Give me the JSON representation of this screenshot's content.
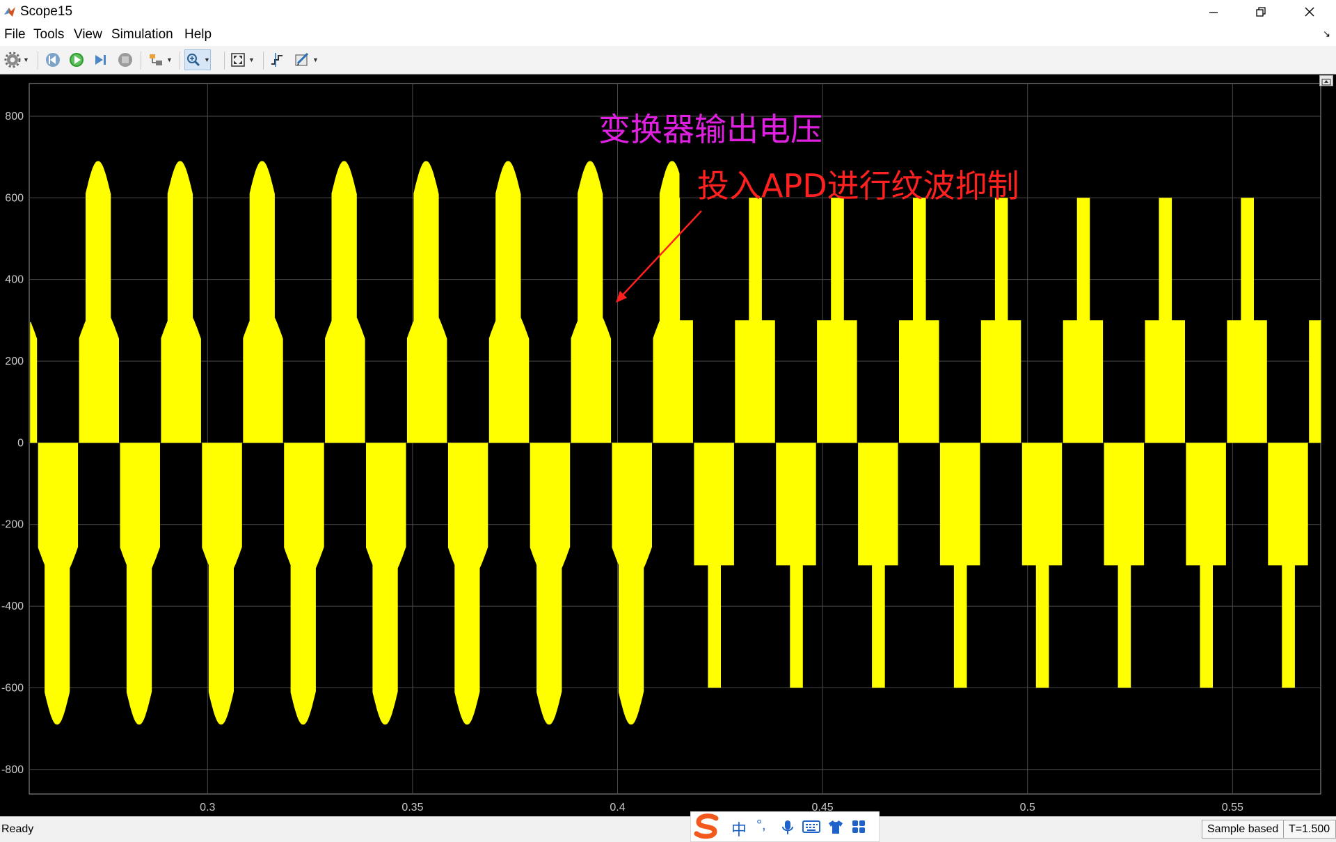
{
  "window": {
    "title": "Scope15",
    "controls": [
      "minimize",
      "restore",
      "close"
    ]
  },
  "menu": [
    {
      "label": "File"
    },
    {
      "label": "Tools"
    },
    {
      "label": "View"
    },
    {
      "label": "Simulation"
    },
    {
      "label": "Help"
    }
  ],
  "toolbar": {
    "icons": [
      "gear-icon",
      "step-back-icon",
      "run-icon",
      "step-forward-icon",
      "stop-icon",
      "highlight-block-icon",
      "zoom-icon",
      "fit-to-view-icon",
      "cursor-measure-icon",
      "style-icon"
    ]
  },
  "annotations": {
    "title_text": "变换器输出电压",
    "title_color": "#e020e0",
    "arrow_text": "投入APD进行纹波抑制",
    "arrow_color": "#ff2020"
  },
  "chart_data": {
    "type": "line",
    "xlim": [
      0.2565,
      0.5715
    ],
    "ylim": [
      -860,
      880
    ],
    "x_ticks": [
      0.3,
      0.35,
      0.4,
      0.45,
      0.5,
      0.55
    ],
    "y_ticks": [
      800,
      600,
      400,
      200,
      0,
      -200,
      -400,
      -600,
      -800
    ],
    "x_tick_labels": [
      "0.3",
      "0.35",
      "0.4",
      "0.45",
      "0.5",
      "0.55"
    ],
    "y_tick_labels": [
      "800",
      "600",
      "400",
      "200",
      "0",
      "-200",
      "-400",
      "-600",
      "-800"
    ],
    "grid": true,
    "series_color": "#ffff00",
    "fundamental_period": 0.02,
    "apd_start_time": 0.415,
    "series": [
      {
        "x": [
          0.257,
          0.259,
          0.2605,
          0.2625,
          0.2645,
          0.266,
          0.2675,
          0.27,
          0.272,
          0.2745,
          0.277,
          0.279,
          0.2805,
          0.2825,
          0.2845,
          0.286,
          0.2875,
          0.29,
          0.292,
          0.2945,
          0.297,
          0.299,
          0.3005,
          0.3025,
          0.3045,
          0.306,
          0.3075,
          0.31,
          0.312,
          0.3145,
          0.317,
          0.319,
          0.3205,
          0.3225,
          0.3245,
          0.326,
          0.3275,
          0.33,
          0.332,
          0.3345,
          0.337,
          0.339,
          0.3405,
          0.3425,
          0.3445,
          0.346,
          0.3475,
          0.35,
          0.352,
          0.3545,
          0.357,
          0.359,
          0.3605,
          0.3625,
          0.3645,
          0.366,
          0.3675,
          0.37,
          0.372,
          0.3745,
          0.377,
          0.379,
          0.3805,
          0.3825,
          0.3845,
          0.386,
          0.3875,
          0.39,
          0.392,
          0.3945,
          0.397,
          0.399,
          0.4005,
          0.4025,
          0.4045,
          0.406,
          0.4075,
          0.41,
          0.412,
          0.4145,
          0.415,
          0.4185,
          0.42,
          0.4235,
          0.425,
          0.429,
          0.43,
          0.4385,
          0.44,
          0.449,
          0.45,
          0.4585,
          0.46,
          0.469,
          0.47,
          0.4785,
          0.48,
          0.489,
          0.49,
          0.4985,
          0.5,
          0.509,
          0.51,
          0.5185,
          0.52,
          0.529,
          0.53,
          0.5385,
          0.54,
          0.549,
          0.55,
          0.5585,
          0.56,
          0.569,
          0.5715
        ],
        "y": [
          -320,
          -260,
          -300,
          -335,
          -300,
          -255,
          -260,
          250,
          330,
          320,
          250,
          260,
          335,
          310,
          255,
          250,
          -250,
          -330,
          -320,
          -250,
          -260,
          -335,
          -310,
          -255,
          -250,
          250,
          330,
          320,
          250,
          260,
          335,
          310,
          255,
          250,
          -250,
          -330,
          -320,
          -250,
          -260,
          -335,
          -310,
          -255,
          -250,
          250,
          330,
          320,
          250,
          260,
          335,
          310,
          255,
          250,
          -250,
          -330,
          -320,
          -250,
          -260,
          -335,
          -310,
          -255,
          -250,
          250,
          330,
          320,
          250,
          260,
          335,
          310,
          255,
          250,
          -250,
          -330,
          -320,
          -250,
          -260,
          -335,
          -310,
          -255,
          -250,
          250,
          320,
          290,
          320,
          300,
          -300,
          -320,
          -300,
          -300,
          300,
          300,
          -300,
          -300,
          300,
          300,
          -300,
          -300,
          300,
          300,
          -300,
          -300,
          300,
          300,
          -300,
          -300,
          300,
          300,
          -300,
          -300,
          300,
          300,
          -300,
          -300,
          300,
          300,
          -300
        ]
      }
    ]
  },
  "status": {
    "ready": "Ready",
    "sample_mode": "Sample based",
    "time": "T=1.500"
  },
  "ime": {
    "zhong": "中",
    "punct": "°,"
  }
}
